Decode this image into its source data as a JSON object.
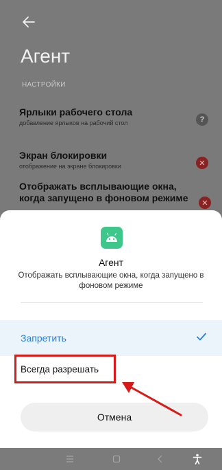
{
  "header": {
    "back_icon": "arrow-left-icon",
    "title": "Агент",
    "section_label": "НАСТРОЙКИ"
  },
  "settings": [
    {
      "title": "Ярлыки рабочего стола",
      "subtitle": "добавление ярлыков на рабочий стол",
      "status_icon": "help-icon"
    },
    {
      "title": "Экран блокировки",
      "subtitle": "отображение на экране блокировки",
      "status_icon": "deny-icon"
    },
    {
      "title": "Отображать всплывающие окна, когда запущено в фоновом режиме",
      "status_icon": "deny-icon"
    }
  ],
  "sheet": {
    "app_icon": "android-icon",
    "app_name": "Агент",
    "description": "Отображать всплывающие окна, когда запущено в фоновом режиме",
    "options": {
      "deny": "Запретить",
      "allow": "Всегда разрешать"
    },
    "cancel_label": "Отмена"
  },
  "navbar": {
    "icons": [
      "menu-icon",
      "home-icon",
      "back-icon",
      "accessibility-icon"
    ]
  },
  "colors": {
    "accent": "#2a7fd6",
    "annotation": "#d61a1a",
    "app_icon_bg": "#3ec78a"
  }
}
